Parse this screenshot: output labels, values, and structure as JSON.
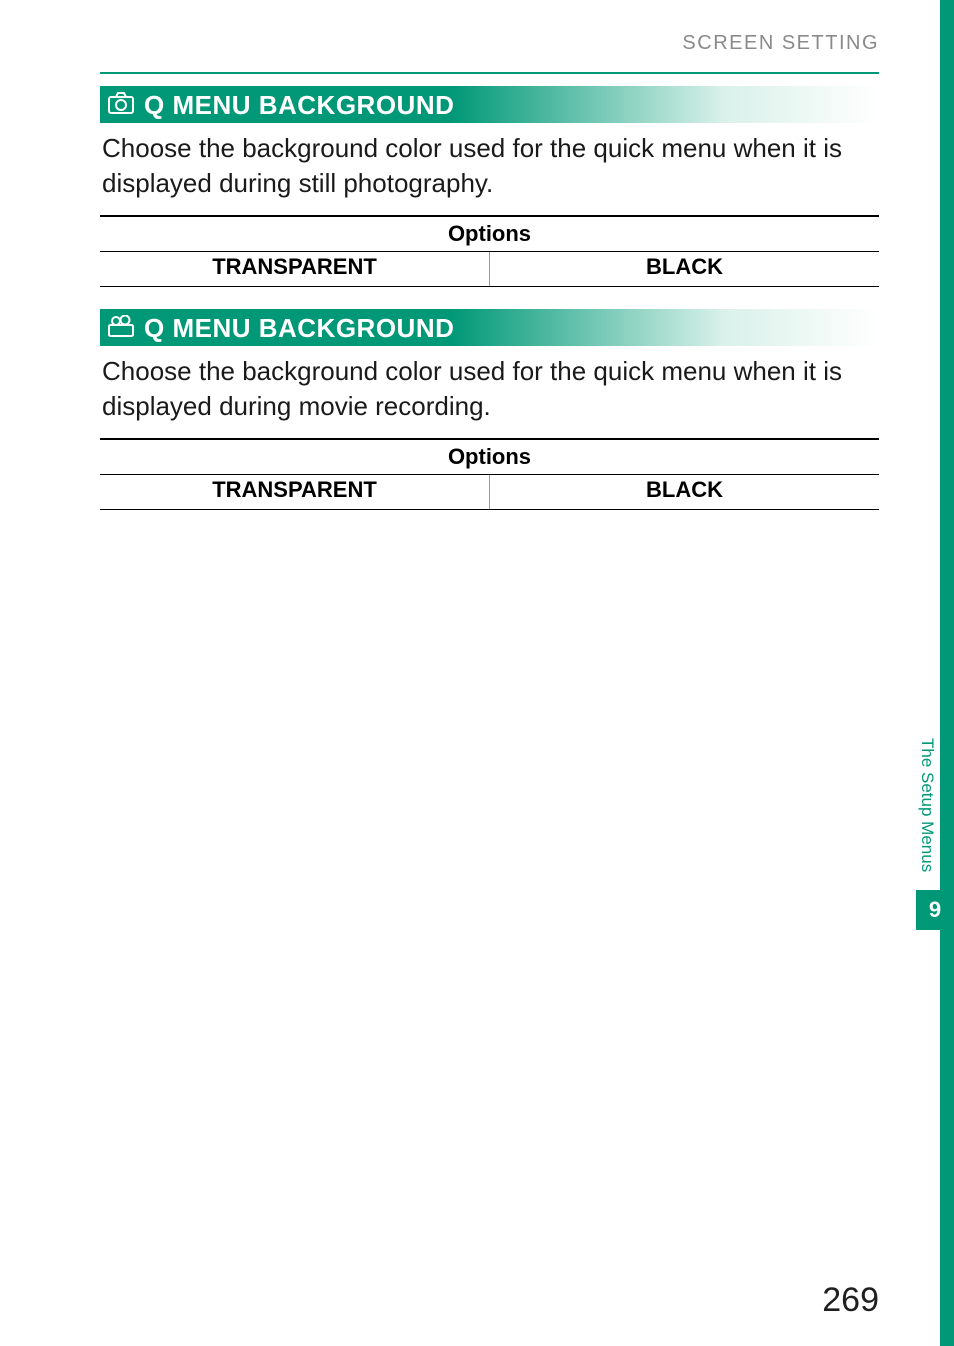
{
  "breadcrumb": "SCREEN SETTING",
  "sections": [
    {
      "icon": "camera-icon",
      "title": "Q MENU BACKGROUND",
      "description": "Choose the background color used for the quick menu when it is displayed during still photography.",
      "options_header": "Options",
      "options": [
        "TRANSPARENT",
        "BLACK"
      ]
    },
    {
      "icon": "movie-icon",
      "title": "Q MENU BACKGROUND",
      "description": "Choose the background color used for the quick menu when it is displayed during movie recording.",
      "options_header": "Options",
      "options": [
        "TRANSPARENT",
        "BLACK"
      ]
    }
  ],
  "side_tab": {
    "label": "The Setup Menus",
    "chapter": "9"
  },
  "page_number": "269"
}
